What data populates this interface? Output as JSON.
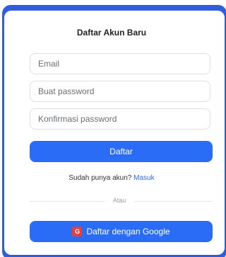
{
  "form": {
    "title": "Daftar Akun Baru",
    "email_placeholder": "Email",
    "password_placeholder": "Buat password",
    "confirm_placeholder": "Konfirmasi password",
    "submit_label": "Daftar",
    "login_prompt": "Sudah punya akun?",
    "login_link": "Masuk",
    "divider_text": "Atau",
    "google_label": "Daftar dengan Google",
    "google_icon_letter": "G"
  },
  "colors": {
    "accent": "#2b6cf6",
    "backdrop": "#2f5fe0",
    "google_icon_bg": "#e0413a"
  }
}
